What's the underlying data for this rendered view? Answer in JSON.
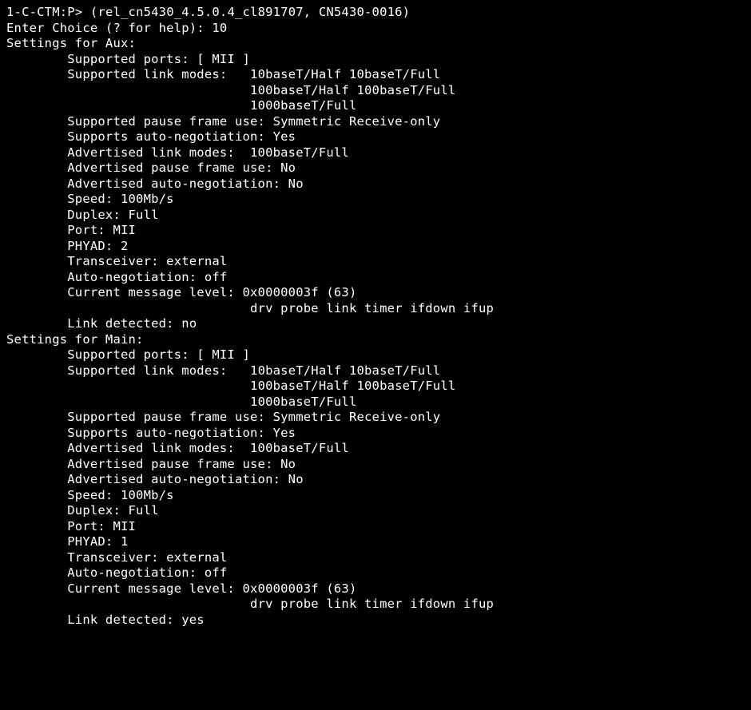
{
  "prompt_prefix": "1-C-CTM:P>",
  "banner": "(rel_cn5430_4.5.0.4_cl891707, CN5430-0016)",
  "enter_choice_label": "Enter Choice (? for help):",
  "enter_choice_value": "10",
  "indent1": "        ",
  "aux": {
    "header": "Settings for Aux:",
    "supported_ports": "Supported ports: [ MII ]",
    "supported_link_modes_label": "Supported link modes:",
    "supported_link_modes_1": "10baseT/Half 10baseT/Full",
    "supported_link_modes_2": "100baseT/Half 100baseT/Full",
    "supported_link_modes_3": "1000baseT/Full",
    "supported_pause": "Supported pause frame use: Symmetric Receive-only",
    "supports_autoneg": "Supports auto-negotiation: Yes",
    "advertised_link_modes": "Advertised link modes:  100baseT/Full",
    "advertised_pause": "Advertised pause frame use: No",
    "advertised_autoneg": "Advertised auto-negotiation: No",
    "speed": "Speed: 100Mb/s",
    "duplex": "Duplex: Full",
    "port": "Port: MII",
    "phyad": "PHYAD: 2",
    "transceiver": "Transceiver: external",
    "autoneg": "Auto-negotiation: off",
    "msg_level": "Current message level: 0x0000003f (63)",
    "msg_level_flags": "drv probe link timer ifdown ifup",
    "link_detected": "Link detected: no"
  },
  "main": {
    "header": "Settings for Main:",
    "supported_ports": "Supported ports: [ MII ]",
    "supported_link_modes_label": "Supported link modes:",
    "supported_link_modes_1": "10baseT/Half 10baseT/Full",
    "supported_link_modes_2": "100baseT/Half 100baseT/Full",
    "supported_link_modes_3": "1000baseT/Full",
    "supported_pause": "Supported pause frame use: Symmetric Receive-only",
    "supports_autoneg": "Supports auto-negotiation: Yes",
    "advertised_link_modes": "Advertised link modes:  100baseT/Full",
    "advertised_pause": "Advertised pause frame use: No",
    "advertised_autoneg": "Advertised auto-negotiation: No",
    "speed": "Speed: 100Mb/s",
    "duplex": "Duplex: Full",
    "port": "Port: MII",
    "phyad": "PHYAD: 1",
    "transceiver": "Transceiver: external",
    "autoneg": "Auto-negotiation: off",
    "msg_level": "Current message level: 0x0000003f (63)",
    "msg_level_flags": "drv probe link timer ifdown ifup",
    "link_detected": "Link detected: yes"
  },
  "col_mode": "                                ",
  "col_slm": "                         "
}
